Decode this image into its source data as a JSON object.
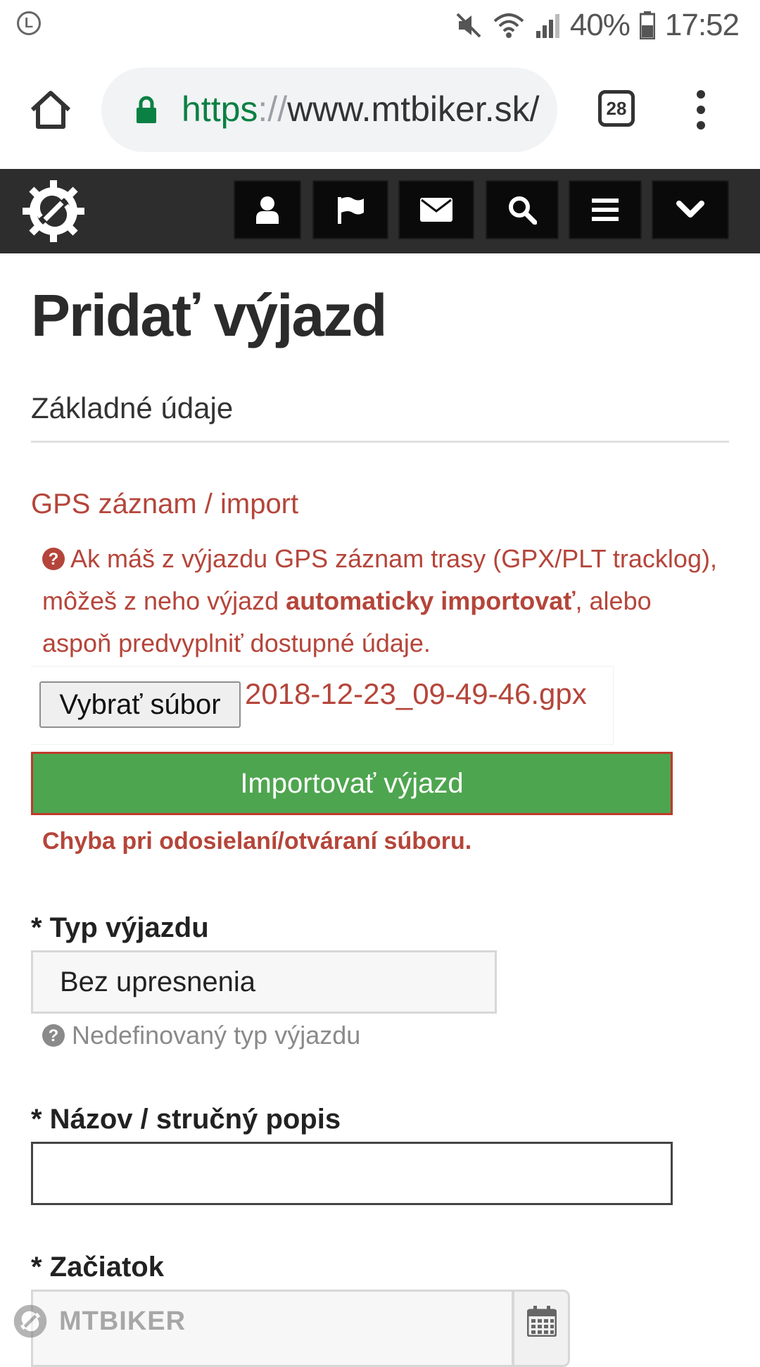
{
  "status_bar": {
    "battery": "40%",
    "time": "17:52",
    "icons": [
      "launcher-icon",
      "mute-icon",
      "wifi-icon",
      "signal-icon",
      "battery-icon"
    ]
  },
  "browser": {
    "url_scheme": "https",
    "url_sep": "://",
    "url_host": "www.mtbiker.sk/",
    "tab_count": "28"
  },
  "site_nav": {
    "buttons": [
      "user-icon",
      "flag-icon",
      "envelope-icon",
      "search-icon",
      "hamburger-menu-icon",
      "chevron-down-icon"
    ]
  },
  "page": {
    "title": "Pridať výjazd",
    "section": "Základné údaje",
    "gps_heading": "GPS záznam / import",
    "gps_help_1": "Ak máš z výjazdu GPS záznam trasy (GPX/PLT tracklog), môžeš z neho výjazd ",
    "gps_help_bold": "automaticky importovať",
    "gps_help_2": ", alebo aspoň predvyplniť dostupné údaje.",
    "file_button": "Vybrať súbor",
    "file_name": "2018-12-23_09-49-46.gpx",
    "import_button": "Importovať výjazd",
    "error": "Chyba pri odosielaní/otváraní súboru.",
    "type_label": "* Typ výjazdu",
    "type_value": "Bez upresnenia",
    "type_help": "Nedefinovaný typ výjazdu",
    "name_label": "* Názov / stručný popis",
    "name_value": "",
    "start_label": "* Začiatok",
    "watermark": "MTBIKER"
  },
  "colors": {
    "accent_red": "#b5453a",
    "import_green": "#4ea54f",
    "nav_bg": "#2d2d2d"
  }
}
